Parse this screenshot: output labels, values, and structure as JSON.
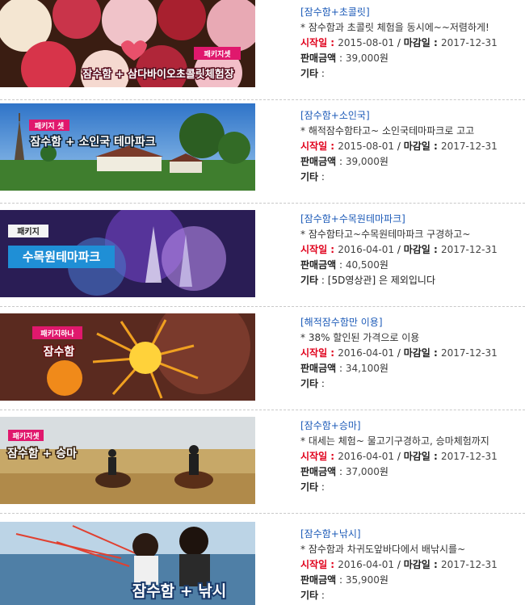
{
  "labels": {
    "start": "시작일",
    "end": "마감일",
    "price": "판매금액",
    "etc": "기타"
  },
  "items": [
    {
      "category": "[잠수함+초콜릿]",
      "desc": "* 잠수함과 초콜릿 체험을 동시에~~저렴하게!",
      "start": "2015-08-01",
      "end": "2017-12-31",
      "price": "39,000",
      "price_unit": "원",
      "etc": "",
      "badge": "패키지셋",
      "caption": "잠수함 + 삼다바이오초콜릿체험장"
    },
    {
      "category": "[잠수함+소인국]",
      "desc": "* 해적잠수함타고~ 소인국테마파크로 고고",
      "start": "2015-08-01",
      "end": "2017-12-31",
      "price": "39,000",
      "price_unit": "원",
      "etc": "",
      "badge": "패키지 셋",
      "caption": "잠수함 + 소인국 테마파크"
    },
    {
      "category": "[잠수함+수목원테마파크]",
      "desc": "* 잠수함타고~수목원테마파크 구경하고~",
      "start": "2016-04-01",
      "end": "2017-12-31",
      "price": "40,500",
      "price_unit": "원",
      "etc": "[5D영상관] 은 제외입니다",
      "badge": "패키지",
      "caption": "수목원테마파크"
    },
    {
      "category": "[해적잠수함만 이용]",
      "desc": "* 38% 할인된 가격으로 이용",
      "start": "2016-04-01",
      "end": "2017-12-31",
      "price": "34,100",
      "price_unit": "원",
      "etc": "",
      "badge": "패키지하나",
      "caption": "잠수함"
    },
    {
      "category": "[잠수함+승마]",
      "desc": "* 대세는 체험~ 물고기구경하고, 승마체험까지",
      "start": "2016-04-01",
      "end": "2017-12-31",
      "price": "37,000",
      "price_unit": "원",
      "etc": "",
      "badge": "패키지셋",
      "caption": "잠수함 + 승마"
    },
    {
      "category": "[잠수함+낚시]",
      "desc": "* 잠수함과 차귀도앞바다에서 배낚시를~",
      "start": "2016-04-01",
      "end": "2017-12-31",
      "price": "35,900",
      "price_unit": "원",
      "etc": "",
      "badge": "",
      "caption": "잠수함 + 낚시"
    }
  ]
}
